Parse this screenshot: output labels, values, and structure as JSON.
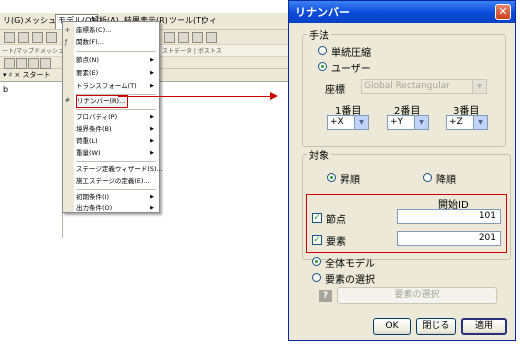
{
  "app": {
    "menubar": [
      "リ(G)",
      "メッシュ(M)",
      "モデル(O)",
      "解析(A)",
      "結果表示(R)",
      "ツール(T)",
      "ウィ"
    ],
    "toolbar_tab_text": "ート/マップドメッシュ",
    "toolbar_right_text": "ストデータ | ポストス",
    "left_tab": "▾ ♯ ×   スタート",
    "left_panel_letter": "b"
  },
  "model_menu": {
    "items": [
      {
        "label": "座標系(C)...",
        "icon": "axis",
        "submenu": false
      },
      {
        "label": "関数(F)...",
        "icon": "function",
        "submenu": false
      },
      {
        "label": "節点(N)",
        "submenu": true
      },
      {
        "label": "要素(E)",
        "submenu": true
      },
      {
        "label": "トランスフォーム(T)",
        "submenu": true
      },
      {
        "label": "リナンバー(R)...",
        "icon": "renumber",
        "submenu": false,
        "highlighted": true
      },
      {
        "label": "プロパティ(P)",
        "submenu": true
      },
      {
        "label": "境界条件(B)",
        "submenu": true
      },
      {
        "label": "荷重(L)",
        "submenu": true
      },
      {
        "label": "重量(W)",
        "submenu": true
      },
      {
        "label": "ステージ定義ウィザード(S)...",
        "submenu": false
      },
      {
        "label": "施工ステージの定義(E)...",
        "submenu": false
      },
      {
        "label": "初期条件(I)",
        "submenu": true
      },
      {
        "label": "出力条件(O)",
        "submenu": true
      }
    ]
  },
  "dialog": {
    "title": "リナンバー",
    "close_glyph": "✕",
    "method": {
      "legend": "手法",
      "option_compress": "単続圧縮",
      "option_user": "ユーザー",
      "selected": "user",
      "coord_label": "座標",
      "coord_value": "Global Rectangular",
      "order_labels": [
        "1番目",
        "2番目",
        "3番目"
      ],
      "order_values": [
        "+X",
        "+Y",
        "+Z"
      ]
    },
    "target": {
      "legend": "対象",
      "ascending": "昇順",
      "descending": "降順",
      "selected_order": "ascending",
      "start_id_header": "開始ID",
      "node_label": "節点",
      "node_checked": true,
      "node_start_id": "101",
      "element_label": "要素",
      "element_checked": true,
      "element_start_id": "201"
    },
    "scope": {
      "whole_model": "全体モデル",
      "selected_elements": "要素の選択",
      "selected": "whole_model",
      "select_button": "要素の選択"
    },
    "buttons": {
      "ok": "OK",
      "close": "閉じる",
      "apply": "適用"
    }
  }
}
